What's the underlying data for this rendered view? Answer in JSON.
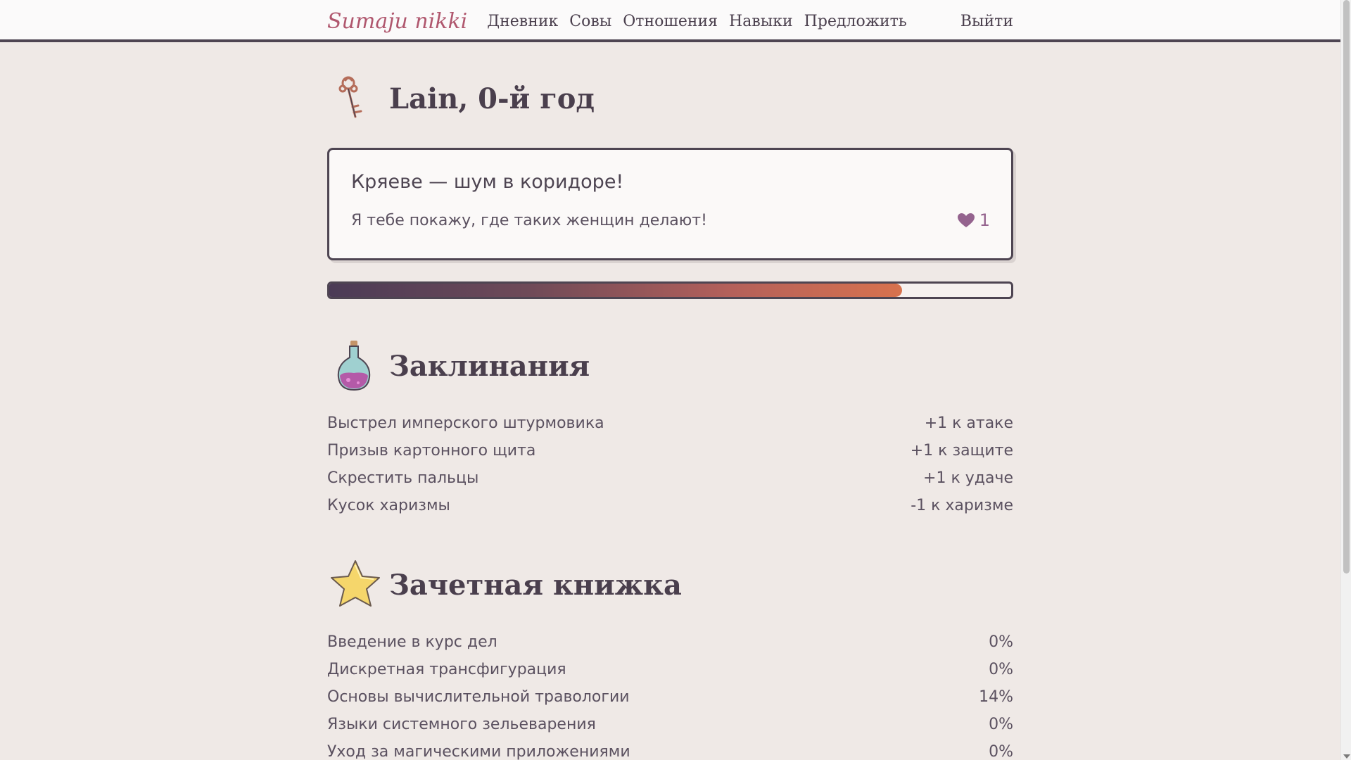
{
  "nav": {
    "logo": "Sumaju nikki",
    "links": [
      "Дневник",
      "Совы",
      "Отношения",
      "Навыки",
      "Предложить"
    ],
    "logout": "Выйти"
  },
  "profile": {
    "title": "Lain, 0-й год",
    "icon": "key-icon"
  },
  "note_card": {
    "title": "Кряеве — шум в коридоре!",
    "text": "Я тебе покажу, где таких женщин делают!",
    "likes": "1"
  },
  "progress": {
    "value_fraction": 0.84
  },
  "spells": {
    "title": "Заклинания",
    "icon": "potion-icon",
    "items": [
      {
        "name": "Выстрел имперского штурмовика",
        "effect": "+1 к атаке"
      },
      {
        "name": "Призыв картонного щита",
        "effect": "+1 к защите"
      },
      {
        "name": "Скрестить пальцы",
        "effect": "+1 к удаче"
      },
      {
        "name": "Кусок харизмы",
        "effect": "-1 к харизме"
      }
    ]
  },
  "gradebook": {
    "title": "Зачетная книжка",
    "icon": "star-icon",
    "items": [
      {
        "name": "Введение в курс дел",
        "value": "0%"
      },
      {
        "name": "Дискретная трансфигурация",
        "value": "0%"
      },
      {
        "name": "Основы вычислительной травологии",
        "value": "14%"
      },
      {
        "name": "Языки системного зельеварения",
        "value": "0%"
      },
      {
        "name": "Уход за магическими приложениями",
        "value": "0%"
      }
    ]
  },
  "colors": {
    "background": "#efe9e6",
    "logo": "#b0576e",
    "text": "#4a3f4d",
    "heart": "#94638e",
    "progress_start": "#4b3b56",
    "progress_end": "#d8724e"
  }
}
